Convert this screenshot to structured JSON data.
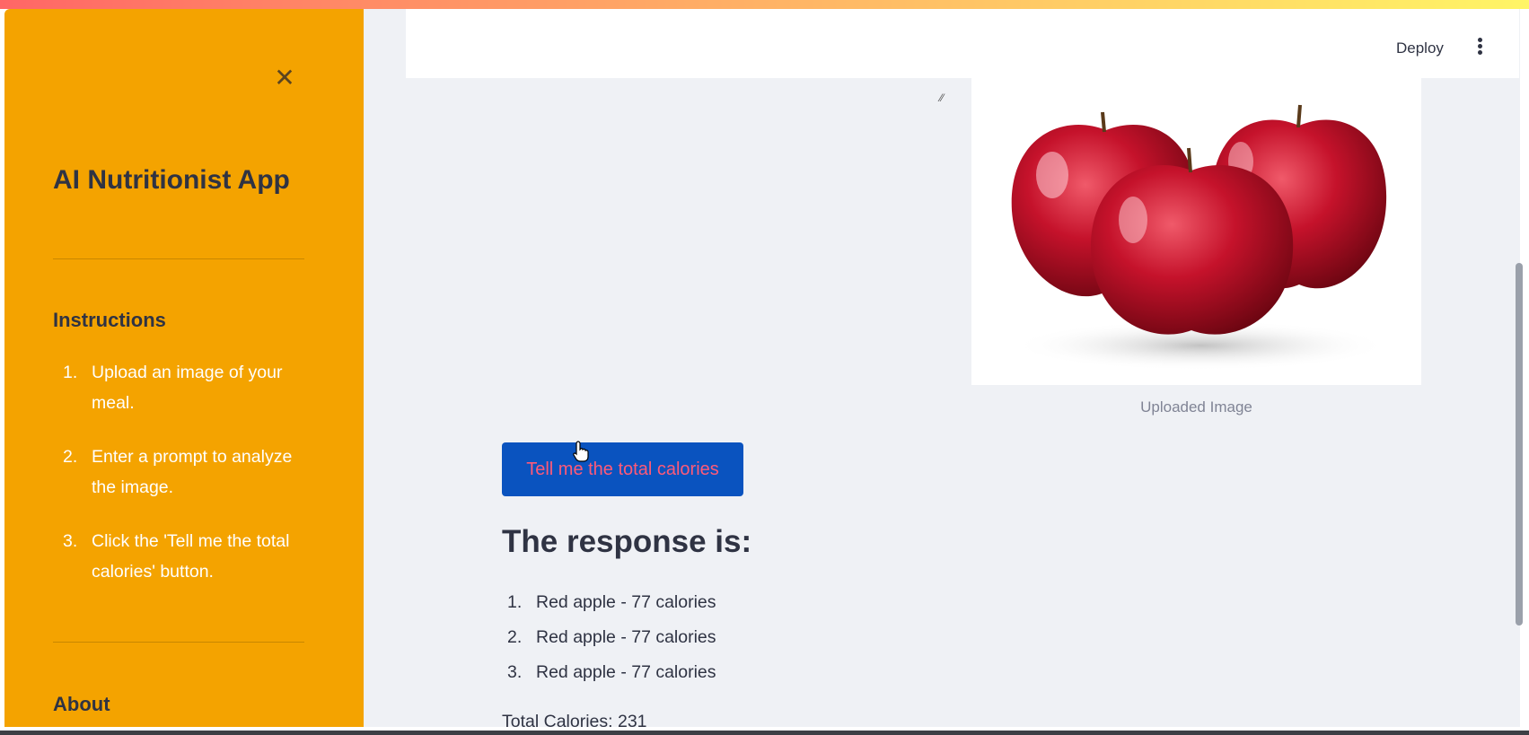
{
  "colors": {
    "sidebar_bg": "#f4a300",
    "main_bg": "#eff1f5",
    "button_bg": "#0a53bf",
    "button_text": "#ff5a78",
    "text_dark": "#2f3343",
    "caption": "#808495"
  },
  "sidebar": {
    "close_icon": "close-icon",
    "title": "AI Nutritionist App",
    "instructions_heading": "Instructions",
    "instructions": [
      {
        "num": "1.",
        "text": "Upload an image of your meal."
      },
      {
        "num": "2.",
        "text": "Enter a prompt to analyze the image."
      },
      {
        "num": "3.",
        "text": "Click the 'Tell me the total calories' button."
      }
    ],
    "about_heading": "About"
  },
  "header": {
    "deploy_label": "Deploy",
    "menu_icon": "more-vertical-icon"
  },
  "main": {
    "image_caption": "Uploaded Image",
    "button_label": "Tell me the total calories",
    "response_title": "The response is:",
    "response_items": [
      {
        "num": "1.",
        "text": "Red apple - 77 calories"
      },
      {
        "num": "2.",
        "text": "Red apple - 77 calories"
      },
      {
        "num": "3.",
        "text": "Red apple - 77 calories"
      }
    ],
    "total": "Total Calories: 231"
  }
}
